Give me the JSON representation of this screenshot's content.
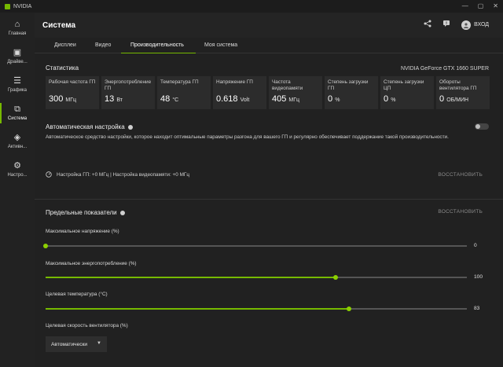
{
  "window": {
    "title": "NVIDIA",
    "controls": [
      "—",
      "▢",
      "✕"
    ]
  },
  "sidebar": {
    "items": [
      {
        "label": "Главная",
        "icon": "home-icon",
        "glyph": "⌂"
      },
      {
        "label": "Драйве...",
        "icon": "drivers-icon",
        "glyph": "▣"
      },
      {
        "label": "Графика",
        "icon": "graphics-sliders-icon",
        "glyph": "☰"
      },
      {
        "label": "Система",
        "icon": "system-icon",
        "glyph": "⧉"
      },
      {
        "label": "Активн...",
        "icon": "activity-icon",
        "glyph": "◈"
      },
      {
        "label": "Настро...",
        "icon": "settings-icon",
        "glyph": "⚙"
      }
    ]
  },
  "header": {
    "title": "Система",
    "login_label": "ВХОД"
  },
  "tabs": [
    {
      "label": "Дисплеи"
    },
    {
      "label": "Видео"
    },
    {
      "label": "Производительность"
    },
    {
      "label": "Моя система"
    }
  ],
  "stats": {
    "title": "Статистика",
    "gpu_name": "NVIDIA GeForce GTX 1660 SUPER",
    "cards": [
      {
        "label": "Рабочая частота ГП",
        "value": "300",
        "unit": "МГц"
      },
      {
        "label": "Энергопотребление ГП",
        "value": "13",
        "unit": "Вт"
      },
      {
        "label": "Температура ГП",
        "value": "48",
        "unit": "°C"
      },
      {
        "label": "Напряжение ГП",
        "value": "0.618",
        "unit": "Volt"
      },
      {
        "label": "Частота видеопамяти",
        "value": "405",
        "unit": "МГц"
      },
      {
        "label": "Степень загрузки ГП",
        "value": "0",
        "unit": "%"
      },
      {
        "label": "Степень загрузки ЦП",
        "value": "0",
        "unit": "%"
      },
      {
        "label": "Обороты вентилятора ГП",
        "value": "0",
        "unit": "ОБ/МИН"
      }
    ]
  },
  "auto_tuning": {
    "title": "Автоматическая настройка",
    "description": "Автоматическое средство настройки, которое находит оптимальные параметры разгона для вашего ГП и регулярно обеспечивает поддержание такой производительности.",
    "status": "Настройка ГП: +0 МГц  |  Настройка видеопамяти: +0 МГц",
    "restore_label": "ВОССТАНОВИТЬ",
    "enabled": false
  },
  "limits": {
    "title": "Предельные показатели",
    "restore_label": "ВОССТАНОВИТЬ",
    "sliders": [
      {
        "label": "Максимальное напряжение (%)",
        "value": "0",
        "fraction": 0.0
      },
      {
        "label": "Максимальное энергопотребление (%)",
        "value": "100",
        "fraction": 0.689
      },
      {
        "label": "Целевая температура (°C)",
        "value": "83",
        "fraction": 0.72
      }
    ],
    "fan_label": "Целевая скорость вентилятора (%)",
    "fan_mode": "Автоматически"
  }
}
